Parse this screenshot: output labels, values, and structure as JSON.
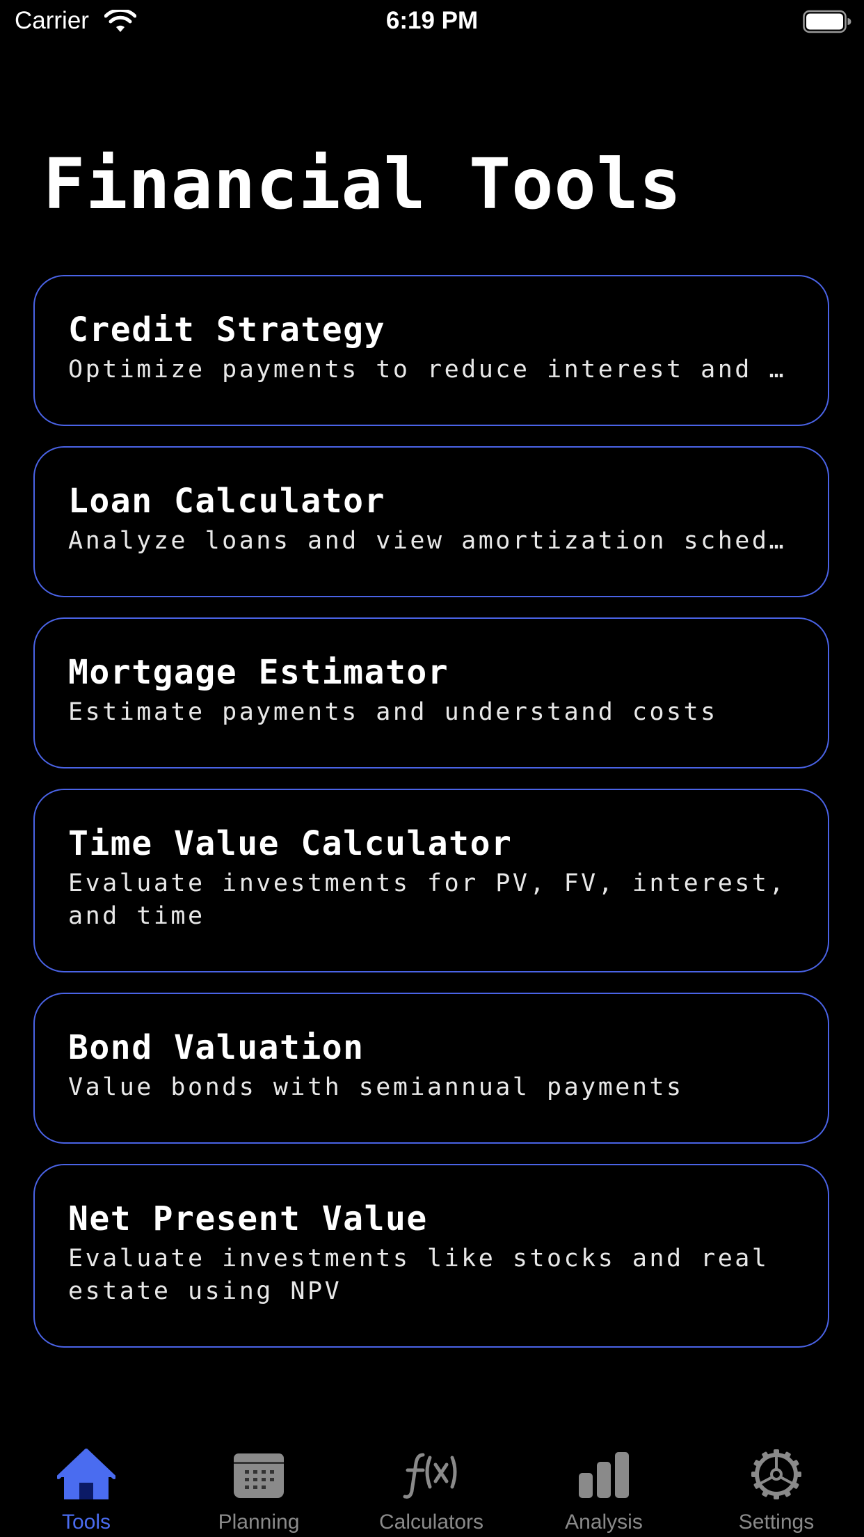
{
  "status_bar": {
    "carrier": "Carrier",
    "time": "6:19 PM",
    "icons": [
      "wifi-icon",
      "battery-icon"
    ]
  },
  "page": {
    "title": "Financial Tools"
  },
  "cards": [
    {
      "title": "Credit Strategy",
      "description": "Optimize payments to reduce interest and b…"
    },
    {
      "title": "Loan Calculator",
      "description": "Analyze loans and view amortization schedu…"
    },
    {
      "title": "Mortgage Estimator",
      "description": "Estimate payments and understand costs"
    },
    {
      "title": "Time Value Calculator",
      "description": "Evaluate investments for PV, FV, interest, and time"
    },
    {
      "title": "Bond Valuation",
      "description": "Value bonds with semiannual payments"
    },
    {
      "title": "Net Present Value",
      "description": "Evaluate investments like stocks and real estate using NPV"
    }
  ],
  "tab_bar": {
    "tabs": [
      {
        "label": "Tools",
        "icon": "house-icon",
        "active": true
      },
      {
        "label": "Planning",
        "icon": "calendar-icon",
        "active": false
      },
      {
        "label": "Calculators",
        "icon": "function-icon",
        "active": false
      },
      {
        "label": "Analysis",
        "icon": "bar-chart-icon",
        "active": false
      },
      {
        "label": "Settings",
        "icon": "gear-icon",
        "active": false
      }
    ]
  },
  "colors": {
    "background": "#000000",
    "accent": "#4a6cf0",
    "card_border": "#4a63e6",
    "inactive_tab": "#8a8a8a"
  }
}
